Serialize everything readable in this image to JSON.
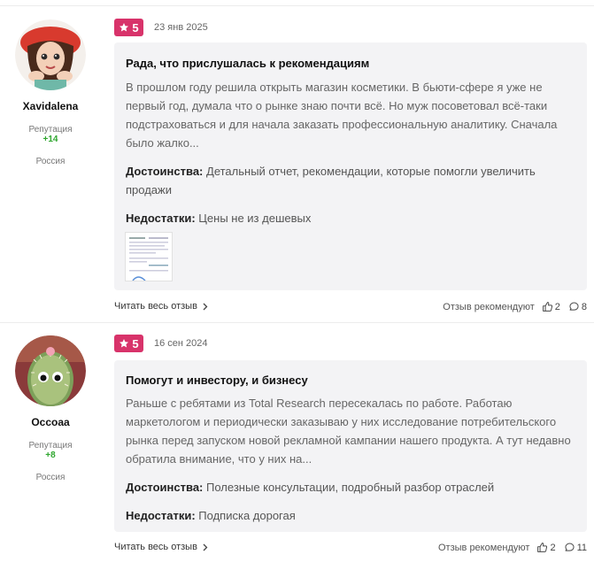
{
  "reviews": [
    {
      "author": {
        "name": "Xavidalena",
        "reputation_label": "Репутация",
        "reputation_value": "+14",
        "country": "Россия"
      },
      "rating": "5",
      "date": "23 янв 2025",
      "title": "Рада, что прислушалась к рекомендациям",
      "text": "В прошлом году решила открыть магазин косметики. В бьюти-сфере я уже не первый год, думала что о рынке знаю почти всё. Но муж посоветовал всё-таки подстраховаться и для начала заказать профессиональную аналитику. Сначала было жалко...",
      "pros_label": "Достоинства:",
      "pros": "Детальный отчет, рекомендации, которые помогли увеличить продажи",
      "cons_label": "Недостатки:",
      "cons": "Цены не из дешевых",
      "read_more": "Читать весь отзыв",
      "recommend_label": "Отзыв рекомендуют",
      "likes": "2",
      "comments": "8"
    },
    {
      "author": {
        "name": "Occoaa",
        "reputation_label": "Репутация",
        "reputation_value": "+8",
        "country": "Россия"
      },
      "rating": "5",
      "date": "16 сен 2024",
      "title": "Помогут и инвестору, и бизнесу",
      "text": "Раньше с ребятами из Total Research пересекалась по работе. Работаю маркетологом и периодически заказываю у них исследование потребительского рынка перед запуском новой рекламной кампании нашего продукта. А тут недавно обратила внимание, что у них на...",
      "pros_label": "Достоинства:",
      "pros": "Полезные консультации, подробный разбор отраслей",
      "cons_label": "Недостатки:",
      "cons": "Подписка дорогая",
      "read_more": "Читать весь отзыв",
      "recommend_label": "Отзыв рекомендуют",
      "likes": "2",
      "comments": "11"
    }
  ],
  "colors": {
    "badge": "#d8336a",
    "reputation": "#2ea62e",
    "card_bg": "#f3f3f5"
  },
  "icons": {
    "rating": "star-icon",
    "readmore": "chevron-right-icon",
    "like": "thumbs-up-icon",
    "comment": "comment-icon"
  }
}
